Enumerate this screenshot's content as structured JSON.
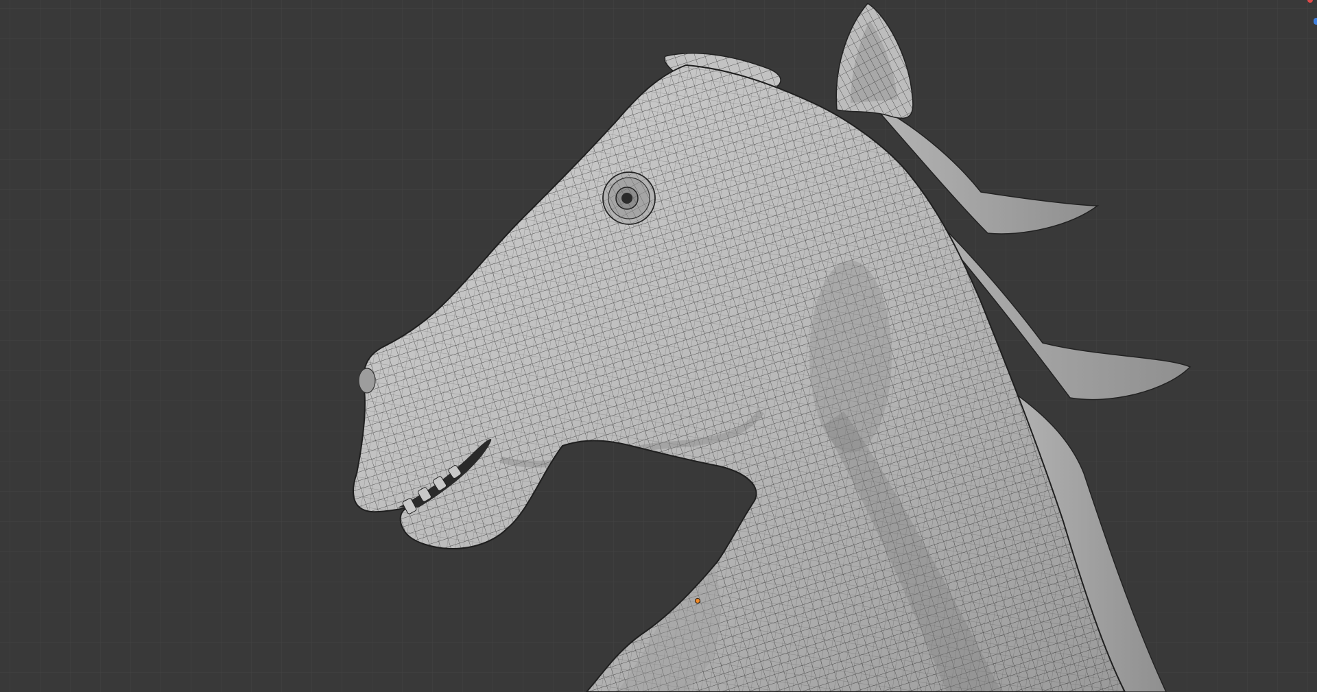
{
  "app": {
    "name": "",
    "view": "3D Viewport"
  },
  "viewport": {
    "background_color": "#393939",
    "grid_color": "#4a4a4a",
    "grid_minor_color": "#424242",
    "mesh_fill_color": "#b9b9b9",
    "mesh_shadow_color": "#8e8e8e",
    "mesh_highlight_color": "#d2d2d2",
    "wire_color": "#2c2c2c",
    "origin_dot_color": "#f08a2a",
    "gizmo_x_color": "#e04a4a",
    "gizmo_z_color": "#3f80e0"
  },
  "object": {
    "name": "",
    "shading": "solid-with-wireframe"
  }
}
